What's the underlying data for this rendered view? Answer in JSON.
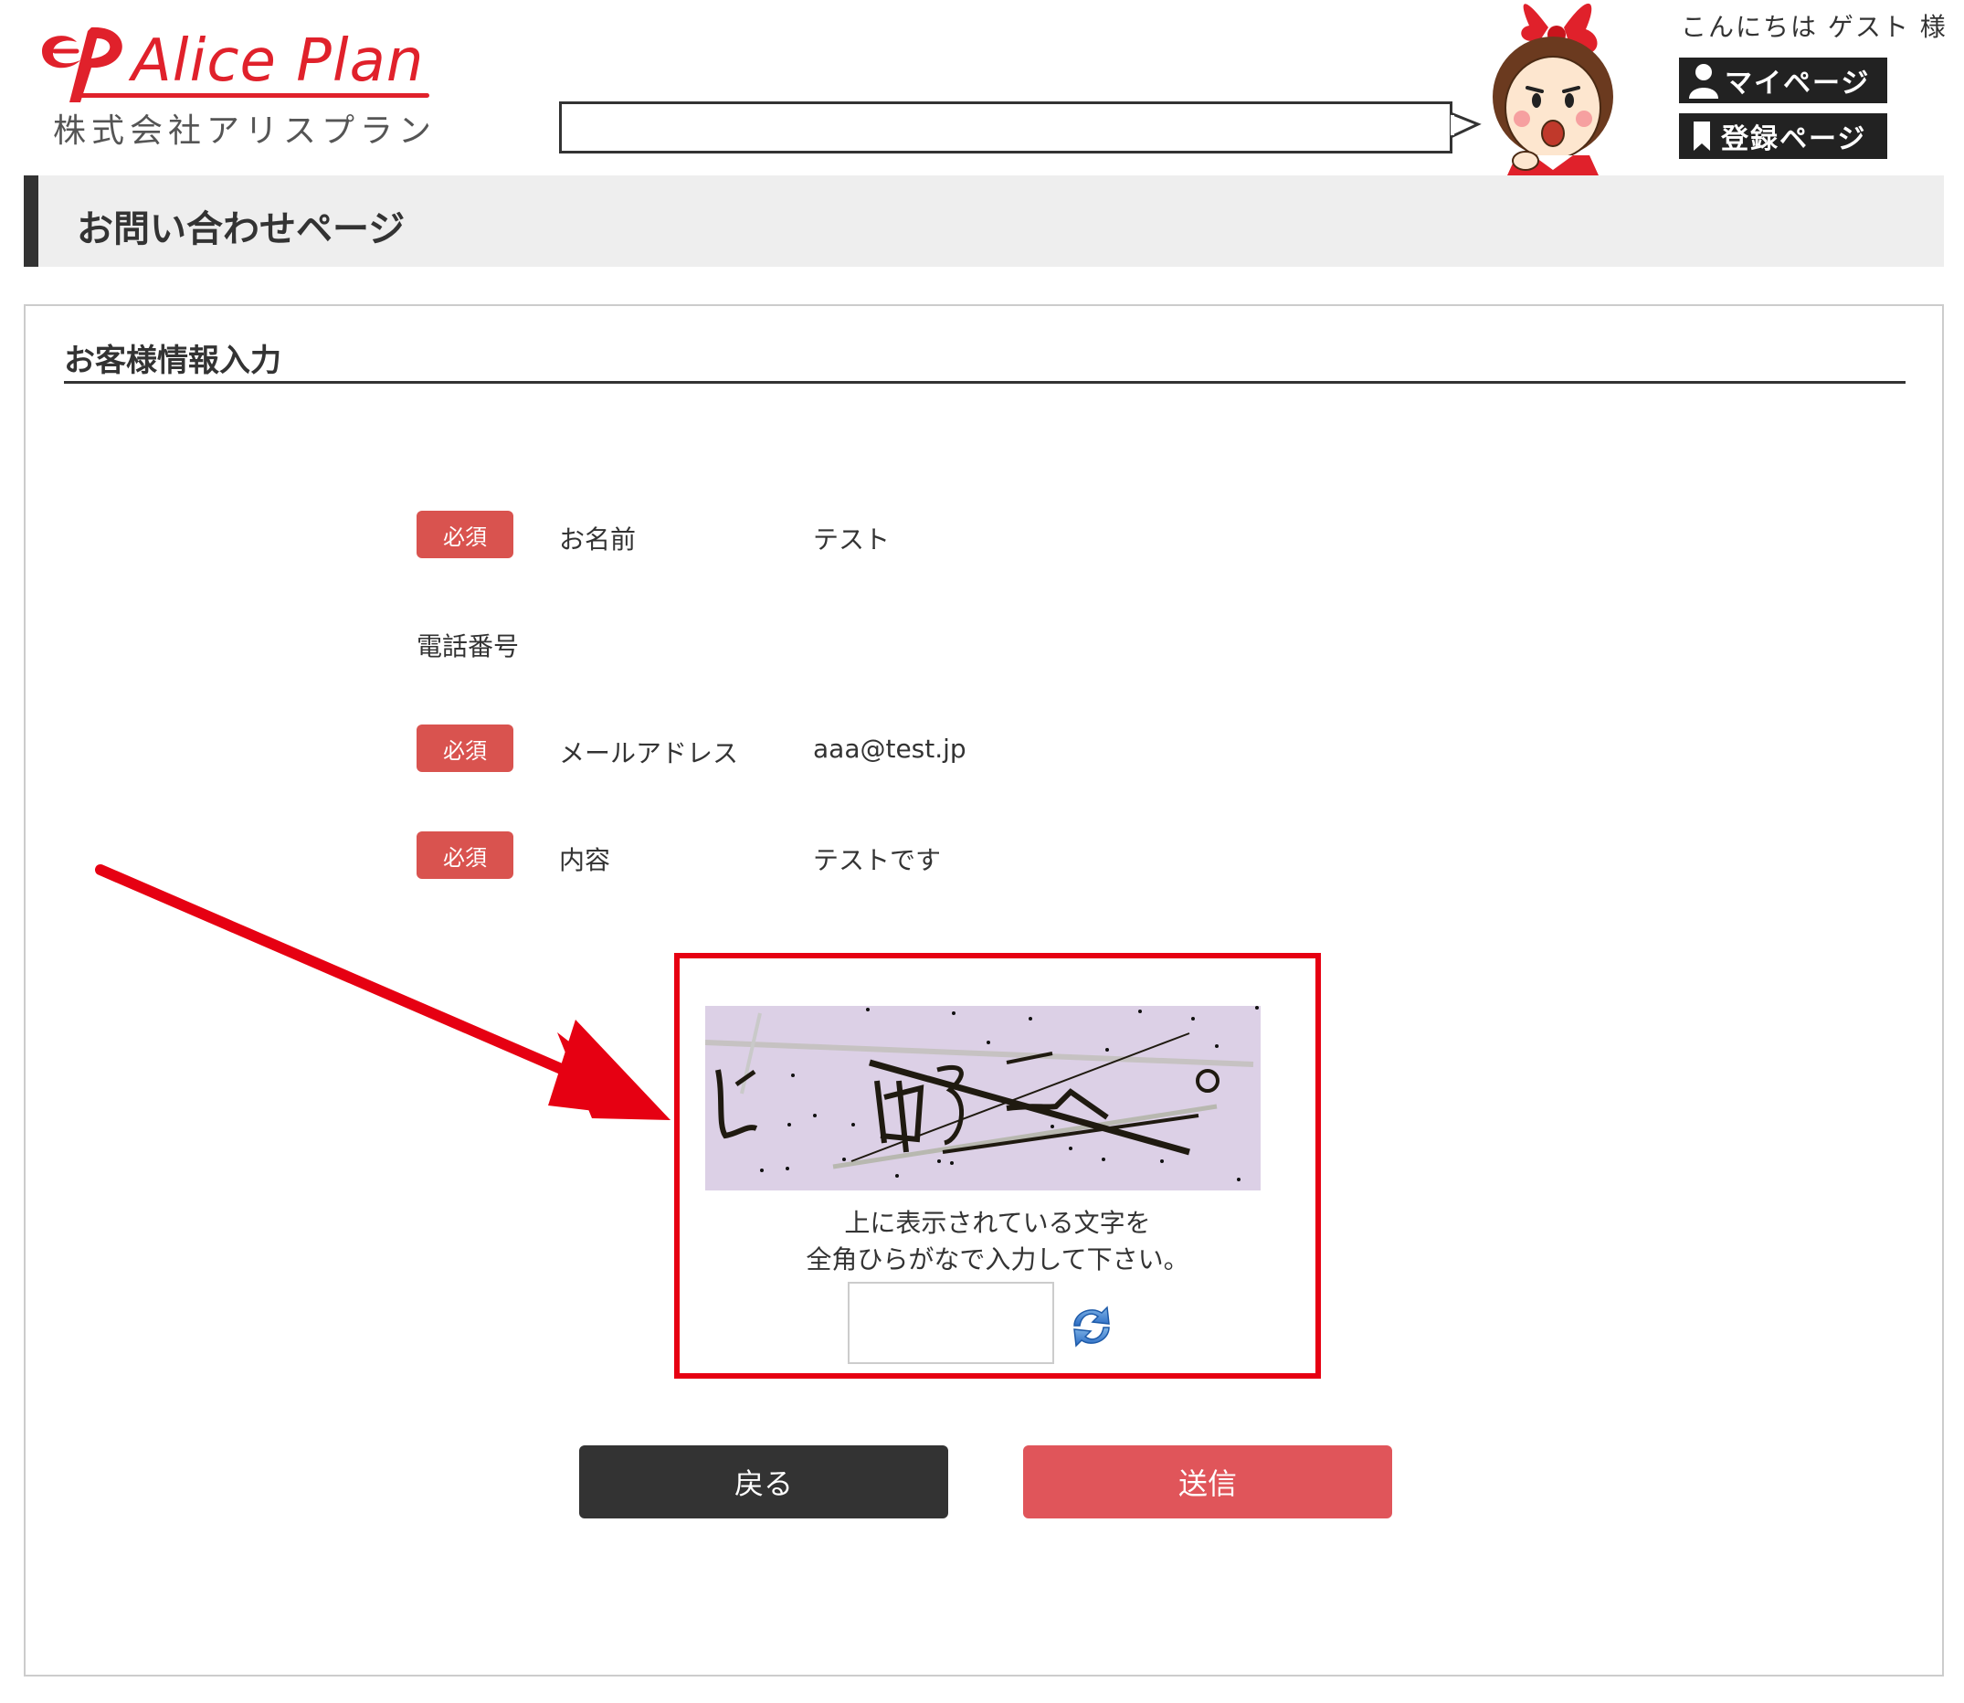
{
  "header": {
    "logo_text": "Alice Plan",
    "logo_subtitle": "株式会社アリスプラン",
    "greeting": "こんにちは ゲスト 様",
    "mypage_label": "マイページ",
    "register_label": "登録ページ"
  },
  "page": {
    "title": "お問い合わせページ"
  },
  "form": {
    "section_title": "お客様情報入力",
    "required_badge": "必須",
    "fields": [
      {
        "label": "お名前",
        "value": "テスト",
        "required": true
      },
      {
        "label": "電話番号",
        "value": "",
        "required": false
      },
      {
        "label": "メールアドレス",
        "value": "aaa@test.jp",
        "required": true
      },
      {
        "label": "内容",
        "value": "テストです",
        "required": true
      }
    ]
  },
  "captcha": {
    "instruction_line1": "上に表示されている文字を",
    "instruction_line2": "全角ひらがなで入力して下さい。",
    "input_value": "",
    "colors": {
      "background": "#dcd0e6",
      "highlight_border": "#e60012"
    }
  },
  "buttons": {
    "back_label": "戻る",
    "submit_label": "送信"
  },
  "colors": {
    "brand_red": "#e0212b",
    "badge_red": "#d9534f",
    "submit_red": "#e0555a",
    "dark": "#333333"
  }
}
